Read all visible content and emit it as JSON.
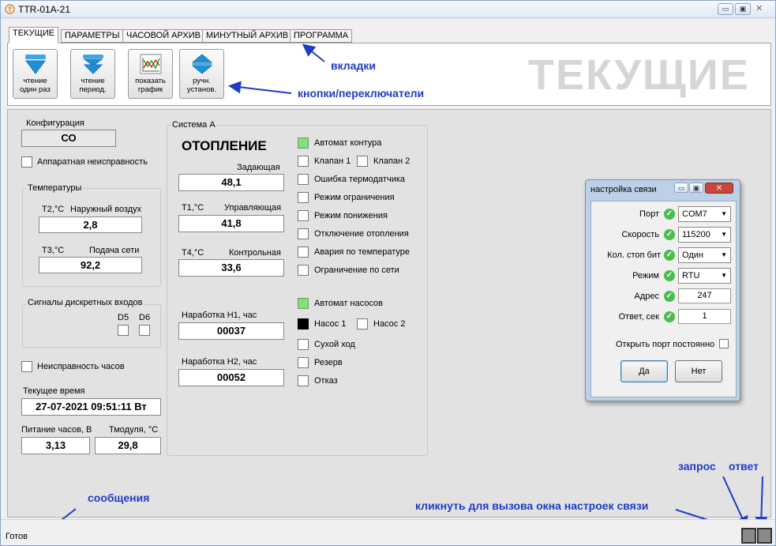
{
  "window": {
    "title": "TTR-01A-21"
  },
  "tabs": [
    "ТЕКУЩИЕ",
    "ПАРАМЕТРЫ",
    "ЧАСОВОЙ АРХИВ",
    "МИНУТНЫЙ АРХИВ",
    "ПРОГРАММА"
  ],
  "toolbar": {
    "read_once": [
      "чтение",
      "один раз"
    ],
    "read_period": [
      "чтение",
      "период."
    ],
    "show_chart": [
      "показать",
      "график"
    ],
    "manual_set": [
      "ручн.",
      "установ."
    ],
    "big_title": "ТЕКУЩИЕ"
  },
  "left": {
    "config_label": "Конфигурация",
    "config_value": "СО",
    "hw_fault": "Аппаратная неисправность",
    "temps_title": "Температуры",
    "t2_label": "Т2,°С",
    "t2_desc": "Наружный воздух",
    "t2_value": "2,8",
    "t3_label": "Т3,°С",
    "t3_desc": "Подача сети",
    "t3_value": "92,2",
    "discrete_title": "Сигналы дискретных входов",
    "d5": "D5",
    "d6": "D6",
    "clock_fault": "Неисправность часов",
    "time_label": "Текущее время",
    "time_value": "27-07-2021 09:51:11 Вт",
    "clock_power_label": "Питание часов, В",
    "clock_power_value": "3,13",
    "module_temp_label": "Тмодуля, °С",
    "module_temp_value": "29,8"
  },
  "system": {
    "title": "Система А",
    "heading": "ОТОПЛЕНИЕ",
    "setpoint_label": "Задающая",
    "setpoint_value": "48,1",
    "t1_label": "Т1,°С",
    "t1_desc": "Управляющая",
    "t1_value": "41,8",
    "t4_label": "Т4,°С",
    "t4_desc": "Контрольная",
    "t4_value": "33,6",
    "h1_label": "Наработка Н1, час",
    "h1_value": "00037",
    "h2_label": "Наработка Н2, час",
    "h2_value": "00052",
    "flags": {
      "auto_circuit": "Автомат контура",
      "valve1": "Клапан 1",
      "valve2": "Клапан 2",
      "thermo_error": "Ошибка термодатчика",
      "limit_mode": "Режим ограничения",
      "lower_mode": "Режим понижения",
      "heating_off": "Отключение отопления",
      "temp_alarm": "Авария по температуре",
      "net_limit": "Ограничение по сети",
      "auto_pumps": "Автомат насосов",
      "pump1": "Насос 1",
      "pump2": "Насос 2",
      "dry_run": "Сухой ход",
      "reserve": "Резерв",
      "failure": "Отказ"
    }
  },
  "dialog": {
    "title": "настройка связи",
    "port_label": "Порт",
    "port_value": "COM7",
    "speed_label": "Скорость",
    "speed_value": "115200",
    "stopbits_label": "Кол. стоп бит",
    "stopbits_value": "Один",
    "mode_label": "Режим",
    "mode_value": "RTU",
    "address_label": "Адрес",
    "address_value": "247",
    "response_label": "Ответ, сек",
    "response_value": "1",
    "keep_open_label": "Открыть порт постоянно",
    "yes": "Да",
    "no": "Нет"
  },
  "annotations": {
    "tabs": "вкладки",
    "buttons": "кнопки/переключатели",
    "messages": "сообщения",
    "click_hint": "кликнуть для вызова окна настроек связи",
    "request": "запрос",
    "response": "ответ"
  },
  "status": {
    "text": "Готов"
  },
  "colors": {
    "accent_annotation": "#1e3cc8",
    "indicator_green": "#8fd68a",
    "ok_check": "#4bbd4b"
  }
}
